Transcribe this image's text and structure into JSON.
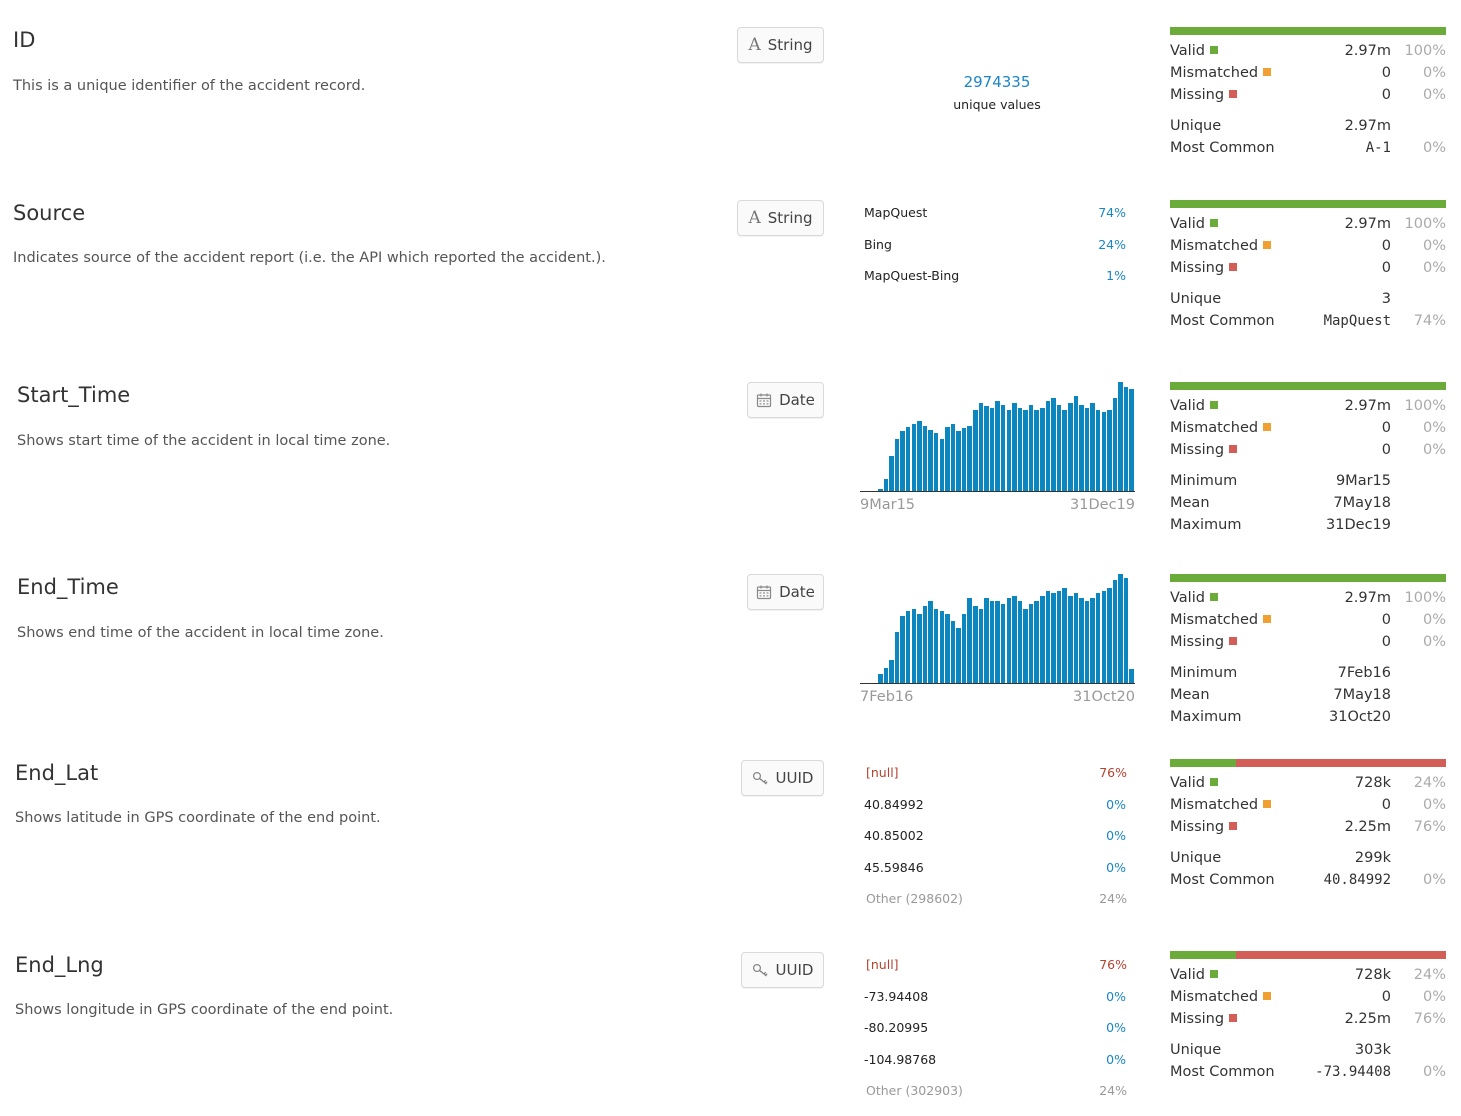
{
  "colors": {
    "valid": "#6aab3a",
    "mismatched": "#f0a030",
    "missing": "#d25e57",
    "bar": "#0b86bf",
    "link": "#1a86c8"
  },
  "labels": {
    "valid": "Valid",
    "mismatched": "Mismatched",
    "missing": "Missing",
    "unique": "Unique",
    "most_common": "Most Common",
    "minimum": "Minimum",
    "mean": "Mean",
    "maximum": "Maximum",
    "unique_values": "unique values"
  },
  "columns": [
    {
      "name": "ID",
      "description": "This is a unique identifier of the accident record.",
      "type": "String",
      "type_icon": "letter-a-icon",
      "unique_count": "2974335",
      "stats": {
        "valid": "2.97m",
        "valid_pct": "100%",
        "mismatched": "0",
        "mismatched_pct": "0%",
        "missing": "0",
        "missing_pct": "0%",
        "unique": "2.97m",
        "most_common": "A-1",
        "most_common_pct": "0%",
        "valid_fraction": 1.0
      }
    },
    {
      "name": "Source",
      "description": "Indicates source of the accident report (i.e. the API which reported the accident.).",
      "type": "String",
      "type_icon": "letter-a-icon",
      "top_values": [
        {
          "value": "MapQuest",
          "pct": "74%"
        },
        {
          "value": "Bing",
          "pct": "24%"
        },
        {
          "value": "MapQuest-Bing",
          "pct": "1%"
        }
      ],
      "stats": {
        "valid": "2.97m",
        "valid_pct": "100%",
        "mismatched": "0",
        "mismatched_pct": "0%",
        "missing": "0",
        "missing_pct": "0%",
        "unique": "3",
        "most_common": "MapQuest",
        "most_common_pct": "74%",
        "valid_fraction": 1.0
      }
    },
    {
      "name": "Start_Time",
      "description": "Shows start time of the accident in local time zone.",
      "type": "Date",
      "type_icon": "calendar-icon",
      "histogram": {
        "min_label": "9Mar15",
        "max_label": "31Dec19",
        "values": [
          2,
          10,
          30,
          45,
          52,
          55,
          58,
          60,
          56,
          53,
          50,
          45,
          55,
          58,
          52,
          54,
          56,
          70,
          76,
          73,
          72,
          78,
          74,
          70,
          76,
          72,
          70,
          74,
          70,
          72,
          78,
          80,
          74,
          70,
          76,
          82,
          74,
          72,
          76,
          70,
          68,
          70,
          80,
          94,
          90,
          88
        ]
      },
      "stats": {
        "valid": "2.97m",
        "valid_pct": "100%",
        "mismatched": "0",
        "mismatched_pct": "0%",
        "missing": "0",
        "missing_pct": "0%",
        "minimum": "9Mar15",
        "mean": "7May18",
        "maximum": "31Dec19",
        "valid_fraction": 1.0
      }
    },
    {
      "name": "End_Time",
      "description": "Shows end time of the accident in local time zone.",
      "type": "Date",
      "type_icon": "calendar-icon",
      "histogram": {
        "min_label": "7Feb16",
        "max_label": "31Oct20",
        "values": [
          7,
          12,
          18,
          40,
          52,
          56,
          58,
          54,
          60,
          64,
          58,
          56,
          54,
          48,
          43,
          54,
          66,
          60,
          58,
          66,
          64,
          64,
          62,
          66,
          68,
          64,
          58,
          62,
          64,
          68,
          72,
          70,
          72,
          74,
          68,
          70,
          66,
          64,
          66,
          70,
          72,
          74,
          80,
          85,
          82,
          11
        ]
      },
      "stats": {
        "valid": "2.97m",
        "valid_pct": "100%",
        "mismatched": "0",
        "mismatched_pct": "0%",
        "missing": "0",
        "missing_pct": "0%",
        "minimum": "7Feb16",
        "mean": "7May18",
        "maximum": "31Oct20",
        "valid_fraction": 1.0
      }
    },
    {
      "name": "End_Lat",
      "description": "Shows latitude in GPS coordinate of the end point.",
      "type": "UUID",
      "type_icon": "key-icon",
      "top_values": [
        {
          "value": "[null]",
          "pct": "76%",
          "kind": "null"
        },
        {
          "value": "40.84992",
          "pct": "0%"
        },
        {
          "value": "40.85002",
          "pct": "0%"
        },
        {
          "value": "45.59846",
          "pct": "0%"
        },
        {
          "value": "Other (298602)",
          "pct": "24%",
          "kind": "other"
        }
      ],
      "stats": {
        "valid": "728k",
        "valid_pct": "24%",
        "mismatched": "0",
        "mismatched_pct": "0%",
        "missing": "2.25m",
        "missing_pct": "76%",
        "unique": "299k",
        "most_common": "40.84992",
        "most_common_pct": "0%",
        "valid_fraction": 0.24
      }
    },
    {
      "name": "End_Lng",
      "description": "Shows longitude in GPS coordinate of the end point.",
      "type": "UUID",
      "type_icon": "key-icon",
      "top_values": [
        {
          "value": "[null]",
          "pct": "76%",
          "kind": "null"
        },
        {
          "value": "-73.94408",
          "pct": "0%"
        },
        {
          "value": "-80.20995",
          "pct": "0%"
        },
        {
          "value": "-104.98768",
          "pct": "0%"
        },
        {
          "value": "Other (302903)",
          "pct": "24%",
          "kind": "other"
        }
      ],
      "stats": {
        "valid": "728k",
        "valid_pct": "24%",
        "mismatched": "0",
        "mismatched_pct": "0%",
        "missing": "2.25m",
        "missing_pct": "76%",
        "unique": "303k",
        "most_common": "-73.94408",
        "most_common_pct": "0%",
        "valid_fraction": 0.24
      }
    }
  ]
}
